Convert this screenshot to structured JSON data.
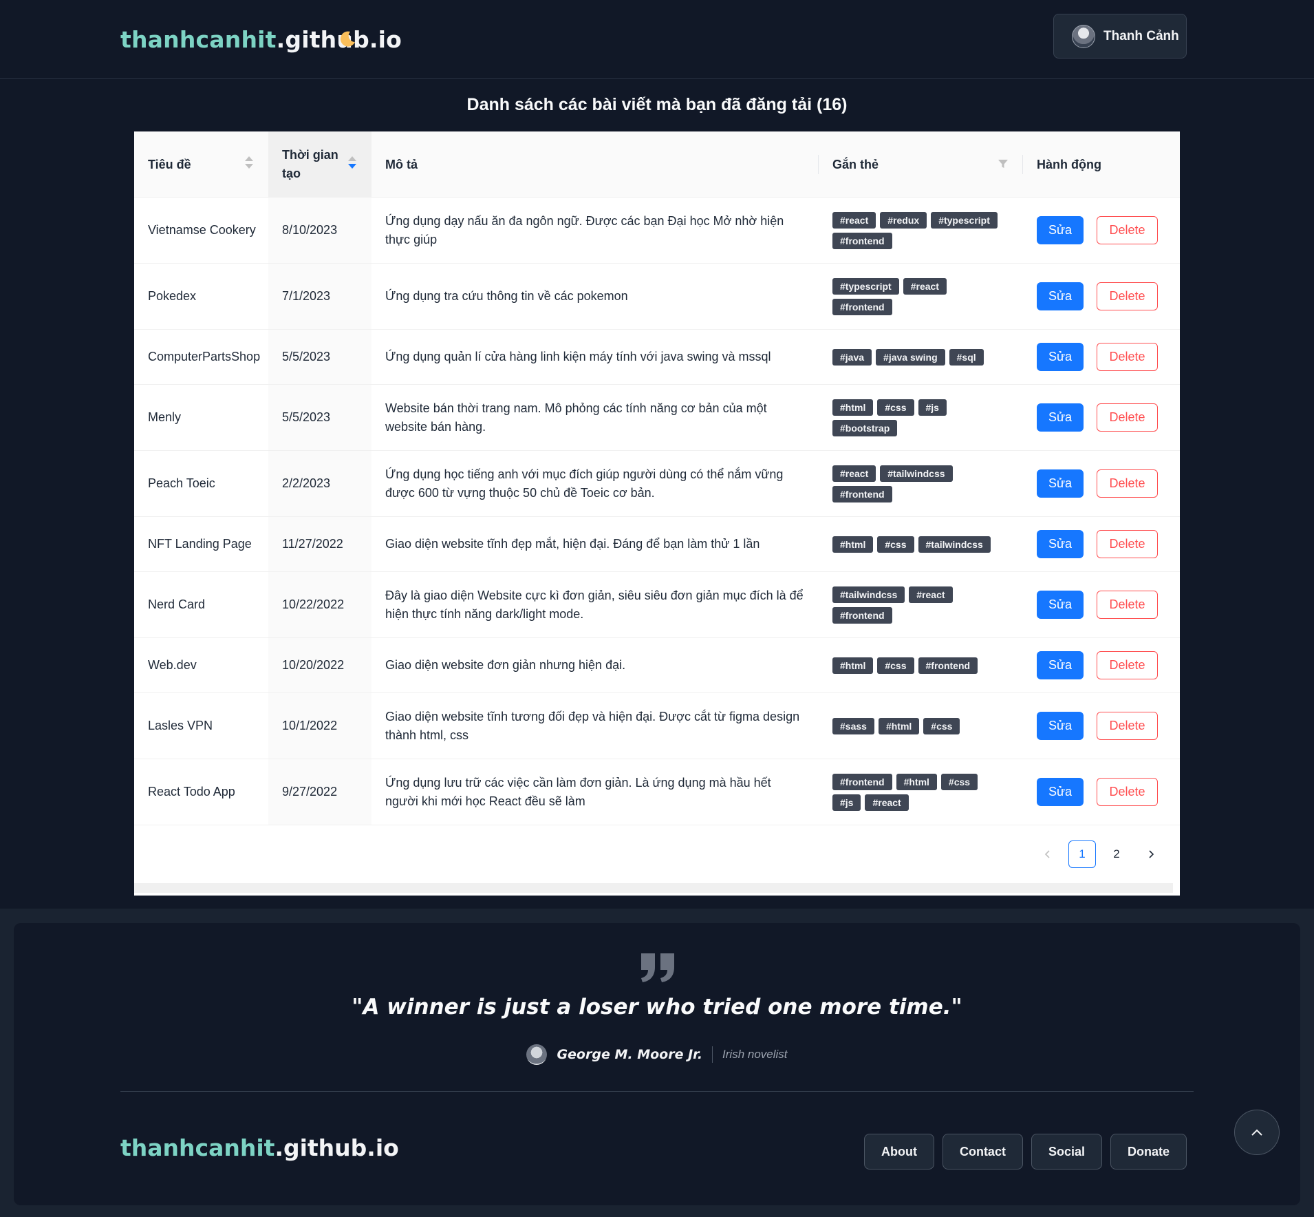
{
  "header": {
    "brand_accent": "thanhcanhit",
    "brand_rest": ".github.io",
    "theme_icon": "moon-icon",
    "user_name": "Thanh Cảnh"
  },
  "page_title": "Danh sách các bài viết mà bạn đã đăng tải (16)",
  "table": {
    "columns": {
      "title": "Tiêu đề",
      "created": "Thời gian tạo",
      "description": "Mô tả",
      "tags": "Gắn thẻ",
      "actions": "Hành động"
    },
    "edit_label": "Sửa",
    "delete_label": "Delete",
    "rows": [
      {
        "title": "Vietnamse Cookery",
        "created": "8/10/2023",
        "description": "Ứng dụng dạy nấu ăn đa ngôn ngữ. Được các bạn Đại học Mở nhờ hiện thực giúp",
        "tags": [
          "#react",
          "#redux",
          "#typescript",
          "#frontend"
        ]
      },
      {
        "title": "Pokedex",
        "created": "7/1/2023",
        "description": "Ứng dụng tra cứu thông tin về các pokemon",
        "tags": [
          "#typescript",
          "#react",
          "#frontend"
        ]
      },
      {
        "title": "ComputerPartsShop",
        "created": "5/5/2023",
        "description": "Ứng dụng quản lí cửa hàng linh kiện máy tính với java swing và mssql",
        "tags": [
          "#java",
          "#java swing",
          "#sql"
        ]
      },
      {
        "title": "Menly",
        "created": "5/5/2023",
        "description": "Website bán thời trang nam. Mô phỏng các tính năng cơ bản của một website bán hàng.",
        "tags": [
          "#html",
          "#css",
          "#js",
          "#bootstrap"
        ]
      },
      {
        "title": "Peach Toeic",
        "created": "2/2/2023",
        "description": "Ứng dụng học tiếng anh với mục đích giúp người dùng có thể nắm vững được 600 từ vựng thuộc 50 chủ đề Toeic cơ bản.",
        "tags": [
          "#react",
          "#tailwindcss",
          "#frontend"
        ]
      },
      {
        "title": "NFT Landing Page",
        "created": "11/27/2022",
        "description": "Giao diện website tĩnh đẹp mắt, hiện đại. Đáng để bạn làm thử 1 lần",
        "tags": [
          "#html",
          "#css",
          "#tailwindcss"
        ]
      },
      {
        "title": "Nerd Card",
        "created": "10/22/2022",
        "description": "Đây là giao diện Website cực kì đơn giản, siêu siêu đơn giản mục đích là để hiện thực tính năng dark/light mode.",
        "tags": [
          "#tailwindcss",
          "#react",
          "#frontend"
        ]
      },
      {
        "title": "Web.dev",
        "created": "10/20/2022",
        "description": "Giao diện website đơn giản nhưng hiện đại.",
        "tags": [
          "#html",
          "#css",
          "#frontend"
        ]
      },
      {
        "title": "Lasles VPN",
        "created": "10/1/2022",
        "description": "Giao diện website tĩnh tương đối đẹp và hiện đại. Được cắt từ figma design thành html, css",
        "tags": [
          "#sass",
          "#html",
          "#css"
        ]
      },
      {
        "title": "React Todo App",
        "created": "9/27/2022",
        "description": "Ứng dụng lưu trữ các việc cần làm đơn giản. Là ứng dụng mà hầu hết người khi mới học React đều sẽ làm",
        "tags": [
          "#frontend",
          "#html",
          "#css",
          "#js",
          "#react"
        ]
      }
    ]
  },
  "pagination": {
    "pages": [
      "1",
      "2"
    ],
    "current": "1"
  },
  "footer": {
    "quote": "\"A winner is just a loser who tried one more time.\"",
    "author": "George M. Moore Jr.",
    "author_role": "Irish novelist",
    "brand_accent": "thanhcanhit",
    "brand_rest": ".github.io",
    "links": [
      "About",
      "Contact",
      "Social",
      "Donate"
    ]
  },
  "colors": {
    "background": "#111827",
    "brand_accent": "#7dd3c4",
    "primary": "#1677ff",
    "danger": "#ff4d4f",
    "tag_bg": "#3f4654"
  }
}
